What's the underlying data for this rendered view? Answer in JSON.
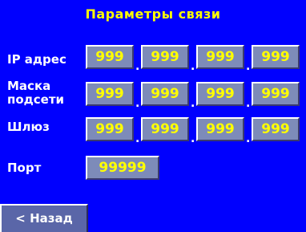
{
  "title": "Параметры связи",
  "ip": {
    "label": "IP адрес",
    "octets": [
      "999",
      "999",
      "999",
      "999"
    ],
    "separator": "."
  },
  "mask": {
    "label_line1": "Маска",
    "label_line2": "подсети",
    "octets": [
      "999",
      "999",
      "999",
      "999"
    ],
    "separator": "."
  },
  "gateway": {
    "label": "Шлюз",
    "octets": [
      "999",
      "999",
      "999",
      "999"
    ],
    "separator": "."
  },
  "port": {
    "label": "Порт",
    "value": "99999"
  },
  "back_button": {
    "label": "< Назад"
  },
  "colors": {
    "background": "#0000fe",
    "field_background": "#7d8bb9",
    "field_text": "#ffff00",
    "label_text": "#ffffff",
    "title_text": "#ffff00"
  }
}
